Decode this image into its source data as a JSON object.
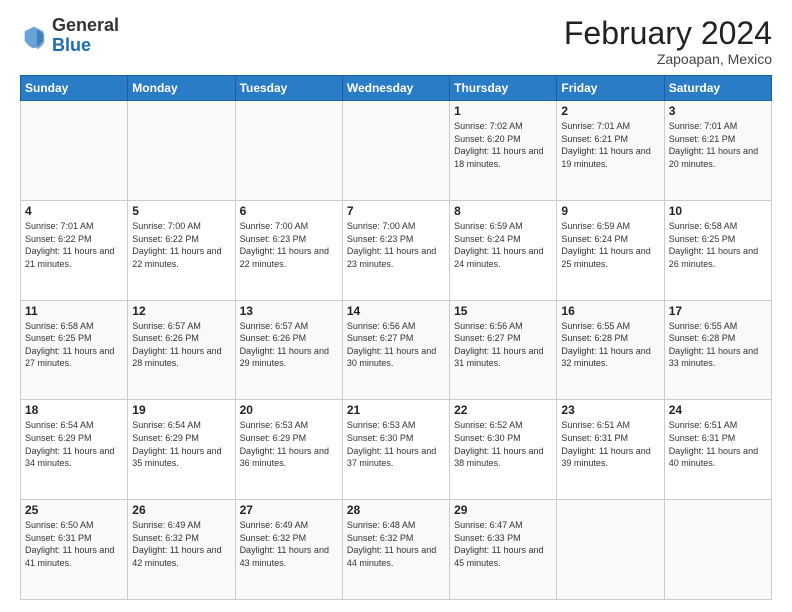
{
  "header": {
    "logo_general": "General",
    "logo_blue": "Blue",
    "month_year": "February 2024",
    "location": "Zapoapan, Mexico"
  },
  "weekdays": [
    "Sunday",
    "Monday",
    "Tuesday",
    "Wednesday",
    "Thursday",
    "Friday",
    "Saturday"
  ],
  "weeks": [
    [
      {
        "day": "",
        "sunrise": "",
        "sunset": "",
        "daylight": ""
      },
      {
        "day": "",
        "sunrise": "",
        "sunset": "",
        "daylight": ""
      },
      {
        "day": "",
        "sunrise": "",
        "sunset": "",
        "daylight": ""
      },
      {
        "day": "",
        "sunrise": "",
        "sunset": "",
        "daylight": ""
      },
      {
        "day": "1",
        "sunrise": "Sunrise: 7:02 AM",
        "sunset": "Sunset: 6:20 PM",
        "daylight": "Daylight: 11 hours and 18 minutes."
      },
      {
        "day": "2",
        "sunrise": "Sunrise: 7:01 AM",
        "sunset": "Sunset: 6:21 PM",
        "daylight": "Daylight: 11 hours and 19 minutes."
      },
      {
        "day": "3",
        "sunrise": "Sunrise: 7:01 AM",
        "sunset": "Sunset: 6:21 PM",
        "daylight": "Daylight: 11 hours and 20 minutes."
      }
    ],
    [
      {
        "day": "4",
        "sunrise": "Sunrise: 7:01 AM",
        "sunset": "Sunset: 6:22 PM",
        "daylight": "Daylight: 11 hours and 21 minutes."
      },
      {
        "day": "5",
        "sunrise": "Sunrise: 7:00 AM",
        "sunset": "Sunset: 6:22 PM",
        "daylight": "Daylight: 11 hours and 22 minutes."
      },
      {
        "day": "6",
        "sunrise": "Sunrise: 7:00 AM",
        "sunset": "Sunset: 6:23 PM",
        "daylight": "Daylight: 11 hours and 22 minutes."
      },
      {
        "day": "7",
        "sunrise": "Sunrise: 7:00 AM",
        "sunset": "Sunset: 6:23 PM",
        "daylight": "Daylight: 11 hours and 23 minutes."
      },
      {
        "day": "8",
        "sunrise": "Sunrise: 6:59 AM",
        "sunset": "Sunset: 6:24 PM",
        "daylight": "Daylight: 11 hours and 24 minutes."
      },
      {
        "day": "9",
        "sunrise": "Sunrise: 6:59 AM",
        "sunset": "Sunset: 6:24 PM",
        "daylight": "Daylight: 11 hours and 25 minutes."
      },
      {
        "day": "10",
        "sunrise": "Sunrise: 6:58 AM",
        "sunset": "Sunset: 6:25 PM",
        "daylight": "Daylight: 11 hours and 26 minutes."
      }
    ],
    [
      {
        "day": "11",
        "sunrise": "Sunrise: 6:58 AM",
        "sunset": "Sunset: 6:25 PM",
        "daylight": "Daylight: 11 hours and 27 minutes."
      },
      {
        "day": "12",
        "sunrise": "Sunrise: 6:57 AM",
        "sunset": "Sunset: 6:26 PM",
        "daylight": "Daylight: 11 hours and 28 minutes."
      },
      {
        "day": "13",
        "sunrise": "Sunrise: 6:57 AM",
        "sunset": "Sunset: 6:26 PM",
        "daylight": "Daylight: 11 hours and 29 minutes."
      },
      {
        "day": "14",
        "sunrise": "Sunrise: 6:56 AM",
        "sunset": "Sunset: 6:27 PM",
        "daylight": "Daylight: 11 hours and 30 minutes."
      },
      {
        "day": "15",
        "sunrise": "Sunrise: 6:56 AM",
        "sunset": "Sunset: 6:27 PM",
        "daylight": "Daylight: 11 hours and 31 minutes."
      },
      {
        "day": "16",
        "sunrise": "Sunrise: 6:55 AM",
        "sunset": "Sunset: 6:28 PM",
        "daylight": "Daylight: 11 hours and 32 minutes."
      },
      {
        "day": "17",
        "sunrise": "Sunrise: 6:55 AM",
        "sunset": "Sunset: 6:28 PM",
        "daylight": "Daylight: 11 hours and 33 minutes."
      }
    ],
    [
      {
        "day": "18",
        "sunrise": "Sunrise: 6:54 AM",
        "sunset": "Sunset: 6:29 PM",
        "daylight": "Daylight: 11 hours and 34 minutes."
      },
      {
        "day": "19",
        "sunrise": "Sunrise: 6:54 AM",
        "sunset": "Sunset: 6:29 PM",
        "daylight": "Daylight: 11 hours and 35 minutes."
      },
      {
        "day": "20",
        "sunrise": "Sunrise: 6:53 AM",
        "sunset": "Sunset: 6:29 PM",
        "daylight": "Daylight: 11 hours and 36 minutes."
      },
      {
        "day": "21",
        "sunrise": "Sunrise: 6:53 AM",
        "sunset": "Sunset: 6:30 PM",
        "daylight": "Daylight: 11 hours and 37 minutes."
      },
      {
        "day": "22",
        "sunrise": "Sunrise: 6:52 AM",
        "sunset": "Sunset: 6:30 PM",
        "daylight": "Daylight: 11 hours and 38 minutes."
      },
      {
        "day": "23",
        "sunrise": "Sunrise: 6:51 AM",
        "sunset": "Sunset: 6:31 PM",
        "daylight": "Daylight: 11 hours and 39 minutes."
      },
      {
        "day": "24",
        "sunrise": "Sunrise: 6:51 AM",
        "sunset": "Sunset: 6:31 PM",
        "daylight": "Daylight: 11 hours and 40 minutes."
      }
    ],
    [
      {
        "day": "25",
        "sunrise": "Sunrise: 6:50 AM",
        "sunset": "Sunset: 6:31 PM",
        "daylight": "Daylight: 11 hours and 41 minutes."
      },
      {
        "day": "26",
        "sunrise": "Sunrise: 6:49 AM",
        "sunset": "Sunset: 6:32 PM",
        "daylight": "Daylight: 11 hours and 42 minutes."
      },
      {
        "day": "27",
        "sunrise": "Sunrise: 6:49 AM",
        "sunset": "Sunset: 6:32 PM",
        "daylight": "Daylight: 11 hours and 43 minutes."
      },
      {
        "day": "28",
        "sunrise": "Sunrise: 6:48 AM",
        "sunset": "Sunset: 6:32 PM",
        "daylight": "Daylight: 11 hours and 44 minutes."
      },
      {
        "day": "29",
        "sunrise": "Sunrise: 6:47 AM",
        "sunset": "Sunset: 6:33 PM",
        "daylight": "Daylight: 11 hours and 45 minutes."
      },
      {
        "day": "",
        "sunrise": "",
        "sunset": "",
        "daylight": ""
      },
      {
        "day": "",
        "sunrise": "",
        "sunset": "",
        "daylight": ""
      }
    ]
  ]
}
